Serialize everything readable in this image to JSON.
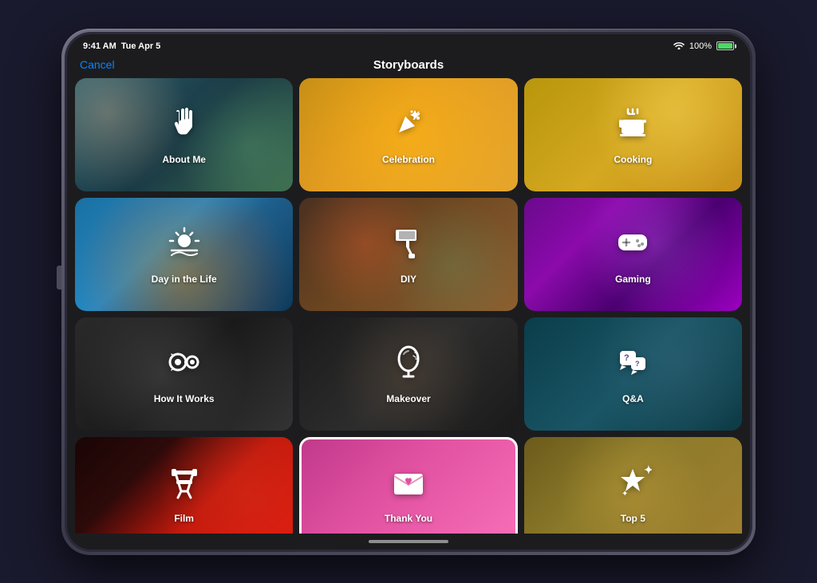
{
  "device": {
    "status_bar": {
      "time": "9:41 AM",
      "date": "Tue Apr 5",
      "wifi": "WiFi",
      "battery_percent": "100%"
    }
  },
  "nav": {
    "cancel_label": "Cancel",
    "title": "Storyboards"
  },
  "grid": {
    "items": [
      {
        "id": "about-me",
        "label": "About Me",
        "bg_class": "bg-about-me",
        "icon": "wave"
      },
      {
        "id": "celebration",
        "label": "Celebration",
        "bg_class": "bg-celebration",
        "icon": "party"
      },
      {
        "id": "cooking",
        "label": "Cooking",
        "bg_class": "bg-cooking",
        "icon": "pot"
      },
      {
        "id": "day-in-life",
        "label": "Day in the Life",
        "bg_class": "bg-day-in-life",
        "icon": "sun-horizon"
      },
      {
        "id": "diy",
        "label": "DIY",
        "bg_class": "bg-diy",
        "icon": "paint-roller"
      },
      {
        "id": "gaming",
        "label": "Gaming",
        "bg_class": "bg-gaming",
        "icon": "gamepad"
      },
      {
        "id": "how-it-works",
        "label": "How It Works",
        "bg_class": "bg-how-it-works",
        "icon": "gear-connect"
      },
      {
        "id": "makeover",
        "label": "Makeover",
        "bg_class": "bg-makeover",
        "icon": "mirror"
      },
      {
        "id": "qa",
        "label": "Q&A",
        "bg_class": "bg-qa",
        "icon": "mic-bubble"
      },
      {
        "id": "film",
        "label": "Film",
        "bg_class": "bg-film",
        "icon": "director-chair"
      },
      {
        "id": "thank-you",
        "label": "Thank You",
        "bg_class": "bg-thank-you bg-thank-you-selected",
        "icon": "envelope-heart",
        "selected": true
      },
      {
        "id": "top5",
        "label": "Top 5",
        "bg_class": "bg-top5",
        "icon": "star-plus"
      }
    ]
  }
}
